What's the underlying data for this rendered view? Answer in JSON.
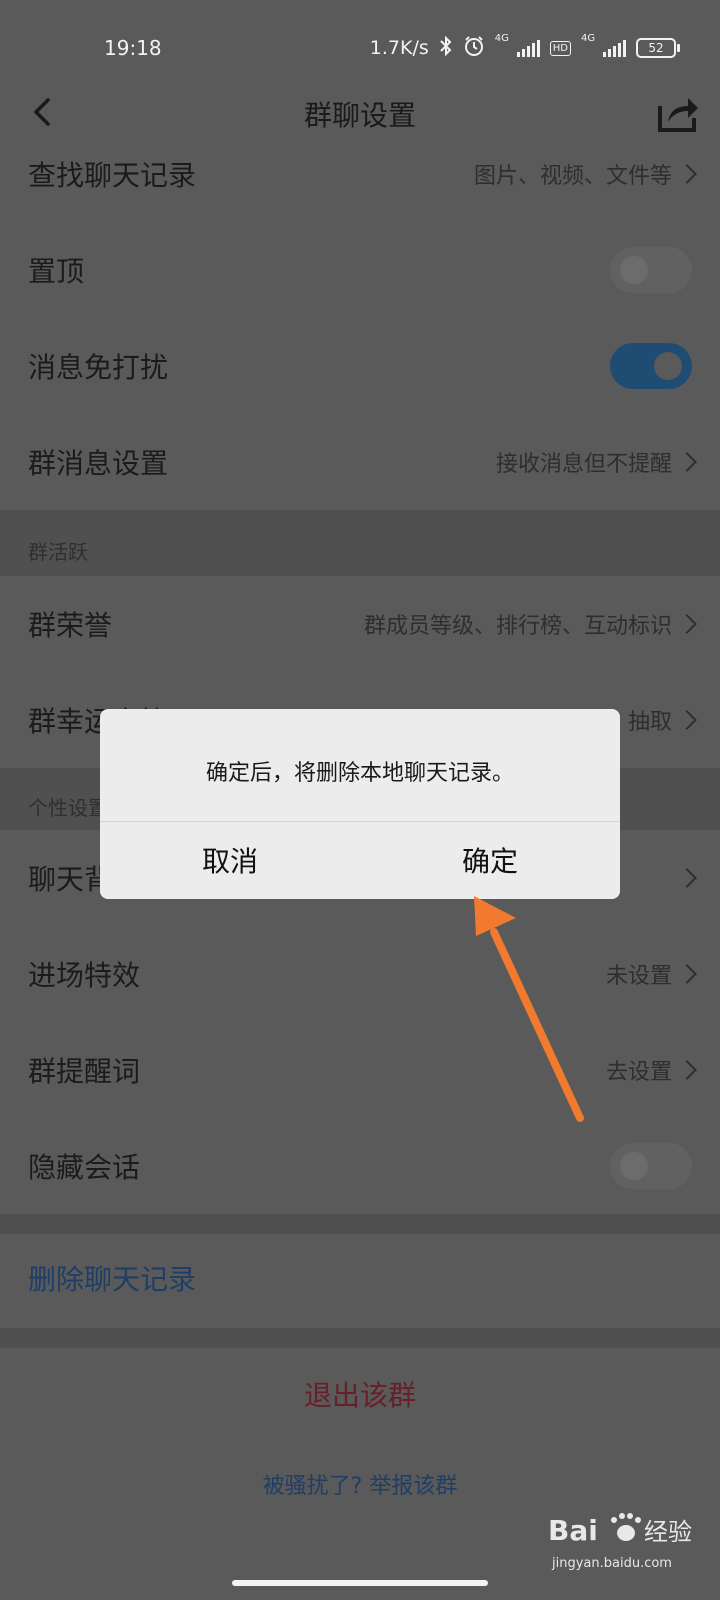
{
  "status_bar": {
    "time": "19:18",
    "net_speed": "1.7K/s",
    "sim1": "4G",
    "hd": "HD",
    "sim2": "4G",
    "battery": "52"
  },
  "header": {
    "title": "群聊设置"
  },
  "rows": {
    "search_history": {
      "label": "查找聊天记录",
      "value": "图片、视频、文件等"
    },
    "pin": {
      "label": "置顶",
      "toggle": "off"
    },
    "dnd": {
      "label": "消息免打扰",
      "toggle": "on"
    },
    "group_msg": {
      "label": "群消息设置",
      "value": "接收消息但不提醒"
    },
    "honor": {
      "label": "群荣誉",
      "value": "群成员等级、排行榜、互动标识"
    },
    "lucky": {
      "label": "群幸运字符",
      "value": "抽取"
    },
    "chat_bg": {
      "label": "聊天背景"
    },
    "entry_effect": {
      "label": "进场特效",
      "value": "未设置"
    },
    "reminder": {
      "label": "群提醒词",
      "value": "去设置"
    },
    "hide_chat": {
      "label": "隐藏会话",
      "toggle": "off"
    }
  },
  "sections": {
    "activity": "群活跃",
    "personal": "个性设置"
  },
  "actions": {
    "delete_history": "删除聊天记录",
    "exit_group": "退出该群",
    "report": "被骚扰了? 举报该群"
  },
  "dialog": {
    "message": "确定后，将删除本地聊天记录。",
    "cancel": "取消",
    "confirm": "确定"
  },
  "watermark": {
    "logo": "Bai 经验",
    "url": "jingyan.baidu.com"
  },
  "colors": {
    "toggle_on": "#1f4c72",
    "link_blue": "#1f3e66",
    "danger_red": "#681f27",
    "annotation_arrow": "#f27a2e",
    "overlay": "#5a5a5a"
  }
}
